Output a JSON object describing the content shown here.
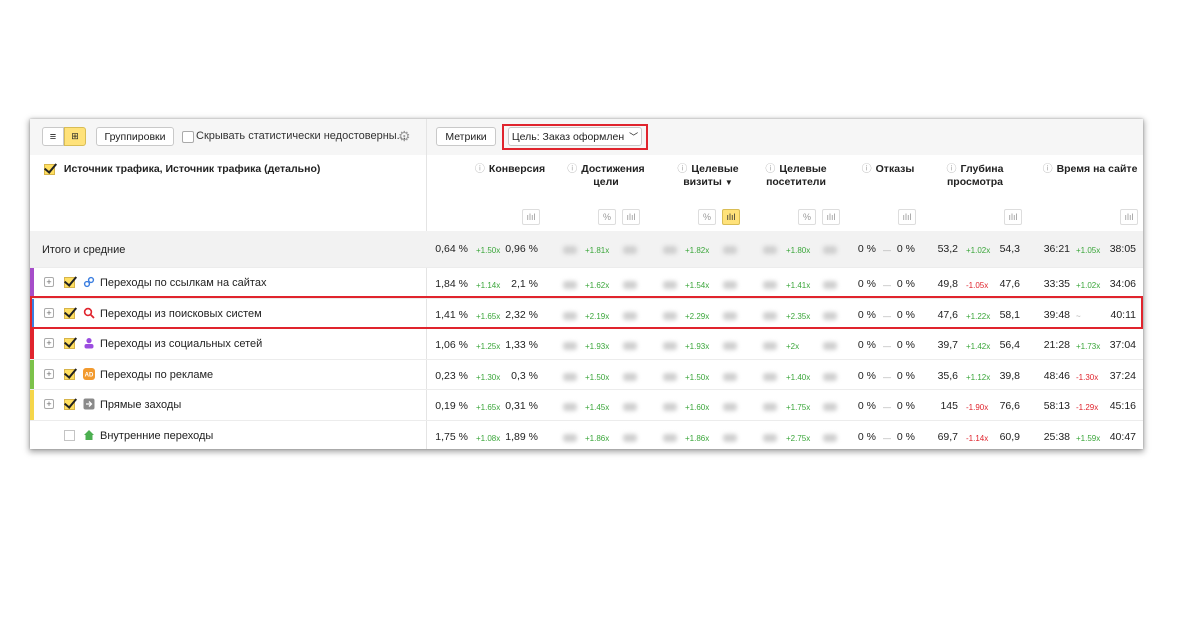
{
  "toolbar": {
    "view_list_icon": "list-icon",
    "view_tree_icon": "tree-icon",
    "groupings_label": "Группировки",
    "hide_unreliable_label": "Скрывать статистически недостоверны...",
    "settings_icon": "gear-icon",
    "metrics_label": "Метрики",
    "goal_label": "Цель: Заказ оформлен"
  },
  "header": {
    "dimension_label": "Источник трафика, Источник трафика (детально)",
    "columns": [
      {
        "label": "Конверсия"
      },
      {
        "label": "Достижения цели"
      },
      {
        "label": "Целевые визиты"
      },
      {
        "label": "Целевые посетители"
      },
      {
        "label": "Отказы"
      },
      {
        "label": "Глубина просмотра"
      },
      {
        "label": "Время на сайте"
      }
    ],
    "toggle_percent": "%",
    "toggle_chart": "ılıl"
  },
  "totals": {
    "label": "Итого и средние",
    "conv": "0,64 %",
    "conv_delta": "+1.50x",
    "conv_cmp": "0,96 %",
    "goal_delta": "+1.81x",
    "visits_delta": "+1.82x",
    "visitors_delta": "+1.80x",
    "bounce": "0 %",
    "bounce_delta": "—",
    "bounce_cmp": "0 %",
    "depth": "53,2",
    "depth_delta": "+1.02x",
    "depth_cmp": "54,3",
    "time": "36:21",
    "time_delta": "+1.05x",
    "time_cmp": "38:05"
  },
  "rows": [
    {
      "label": "Переходы по ссылкам на сайтах",
      "icon": "link-icon",
      "color": "#a64dc9",
      "checked": true,
      "conv": "1,84 %",
      "conv_delta": "+1.14x",
      "conv_cmp": "2,1 %",
      "goal_delta": "+1.62x",
      "visits_delta": "+1.54x",
      "visitors_delta": "+1.41x",
      "bounce": "0 %",
      "bounce_delta": "—",
      "bounce_cmp": "0 %",
      "depth": "49,8",
      "depth_delta": "-1.05x",
      "depth_cmp": "47,6",
      "time": "33:35",
      "time_delta": "+1.02x",
      "time_cmp": "34:06"
    },
    {
      "label": "Переходы из поисковых систем",
      "icon": "search-icon",
      "color": "#3b7ee0",
      "checked": true,
      "conv": "1,41 %",
      "conv_delta": "+1.65x",
      "conv_cmp": "2,32 %",
      "goal_delta": "+2.19x",
      "visits_delta": "+2.29x",
      "visitors_delta": "+2.35x",
      "bounce": "0 %",
      "bounce_delta": "—",
      "bounce_cmp": "0 %",
      "depth": "47,6",
      "depth_delta": "+1.22x",
      "depth_cmp": "58,1",
      "time": "39:48",
      "time_delta": "~",
      "time_cmp": "40:11"
    },
    {
      "label": "Переходы из социальных сетей",
      "icon": "person-icon",
      "color": "#e0242d",
      "checked": true,
      "conv": "1,06 %",
      "conv_delta": "+1.25x",
      "conv_cmp": "1,33 %",
      "goal_delta": "+1.93x",
      "visits_delta": "+1.93x",
      "visitors_delta": "+2x",
      "bounce": "0 %",
      "bounce_delta": "—",
      "bounce_cmp": "0 %",
      "depth": "39,7",
      "depth_delta": "+1.42x",
      "depth_cmp": "56,4",
      "time": "21:28",
      "time_delta": "+1.73x",
      "time_cmp": "37:04"
    },
    {
      "label": "Переходы по рекламе",
      "icon": "ad-icon",
      "color": "#7cc24a",
      "checked": true,
      "conv": "0,23 %",
      "conv_delta": "+1.30x",
      "conv_cmp": "0,3 %",
      "goal_delta": "+1.50x",
      "visits_delta": "+1.50x",
      "visitors_delta": "+1.40x",
      "bounce": "0 %",
      "bounce_delta": "—",
      "bounce_cmp": "0 %",
      "depth": "35,6",
      "depth_delta": "+1.12x",
      "depth_cmp": "39,8",
      "time": "48:46",
      "time_delta": "-1.30x",
      "time_cmp": "37:24"
    },
    {
      "label": "Прямые заходы",
      "icon": "direct-icon",
      "color": "#f5d64a",
      "checked": true,
      "conv": "0,19 %",
      "conv_delta": "+1.65x",
      "conv_cmp": "0,31 %",
      "goal_delta": "+1.45x",
      "visits_delta": "+1.60x",
      "visitors_delta": "+1.75x",
      "bounce": "0 %",
      "bounce_delta": "—",
      "bounce_cmp": "0 %",
      "depth": "145",
      "depth_delta": "-1.90x",
      "depth_cmp": "76,6",
      "time": "58:13",
      "time_delta": "-1.29x",
      "time_cmp": "45:16"
    },
    {
      "label": "Внутренние переходы",
      "icon": "home-icon",
      "color": "#ffffff",
      "checked": false,
      "conv": "1,75 %",
      "conv_delta": "+1.08x",
      "conv_cmp": "1,89 %",
      "goal_delta": "+1.86x",
      "visits_delta": "+1.86x",
      "visitors_delta": "+2.75x",
      "bounce": "0 %",
      "bounce_delta": "—",
      "bounce_cmp": "0 %",
      "depth": "69,7",
      "depth_delta": "-1.14x",
      "depth_cmp": "60,9",
      "time": "25:38",
      "time_delta": "+1.59x",
      "time_cmp": "40:47"
    }
  ]
}
